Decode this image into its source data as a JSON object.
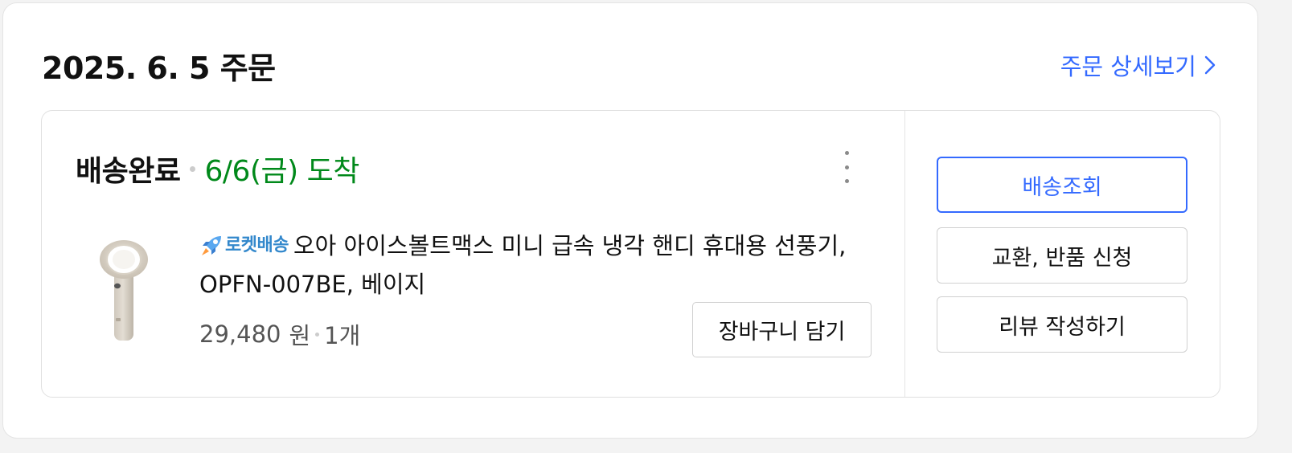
{
  "order": {
    "date_title": "2025. 6. 5 주문",
    "detail_link_label": "주문 상세보기"
  },
  "shipment": {
    "status": "배송완료",
    "arrival": "6/6(금) 도착"
  },
  "product": {
    "badge_label": "로켓배송",
    "name": "오아 아이스볼트맥스 미니 급속 냉각 핸디 휴대용 선풍기, OPFN-007BE, 베이지",
    "price": "29,480",
    "currency": "원",
    "quantity": "1개"
  },
  "actions": {
    "add_to_cart": "장바구니 담기",
    "track_delivery": "배송조회",
    "exchange_return": "교환, 반품 신청",
    "write_review": "리뷰 작성하기"
  },
  "icons": {
    "more": "more-vertical-icon",
    "detail_arrow": "chevron-right-icon",
    "rocket": "rocket-icon"
  },
  "colors": {
    "accent": "#346aff",
    "arrival": "#00891a",
    "rocket": "#3388cc"
  }
}
